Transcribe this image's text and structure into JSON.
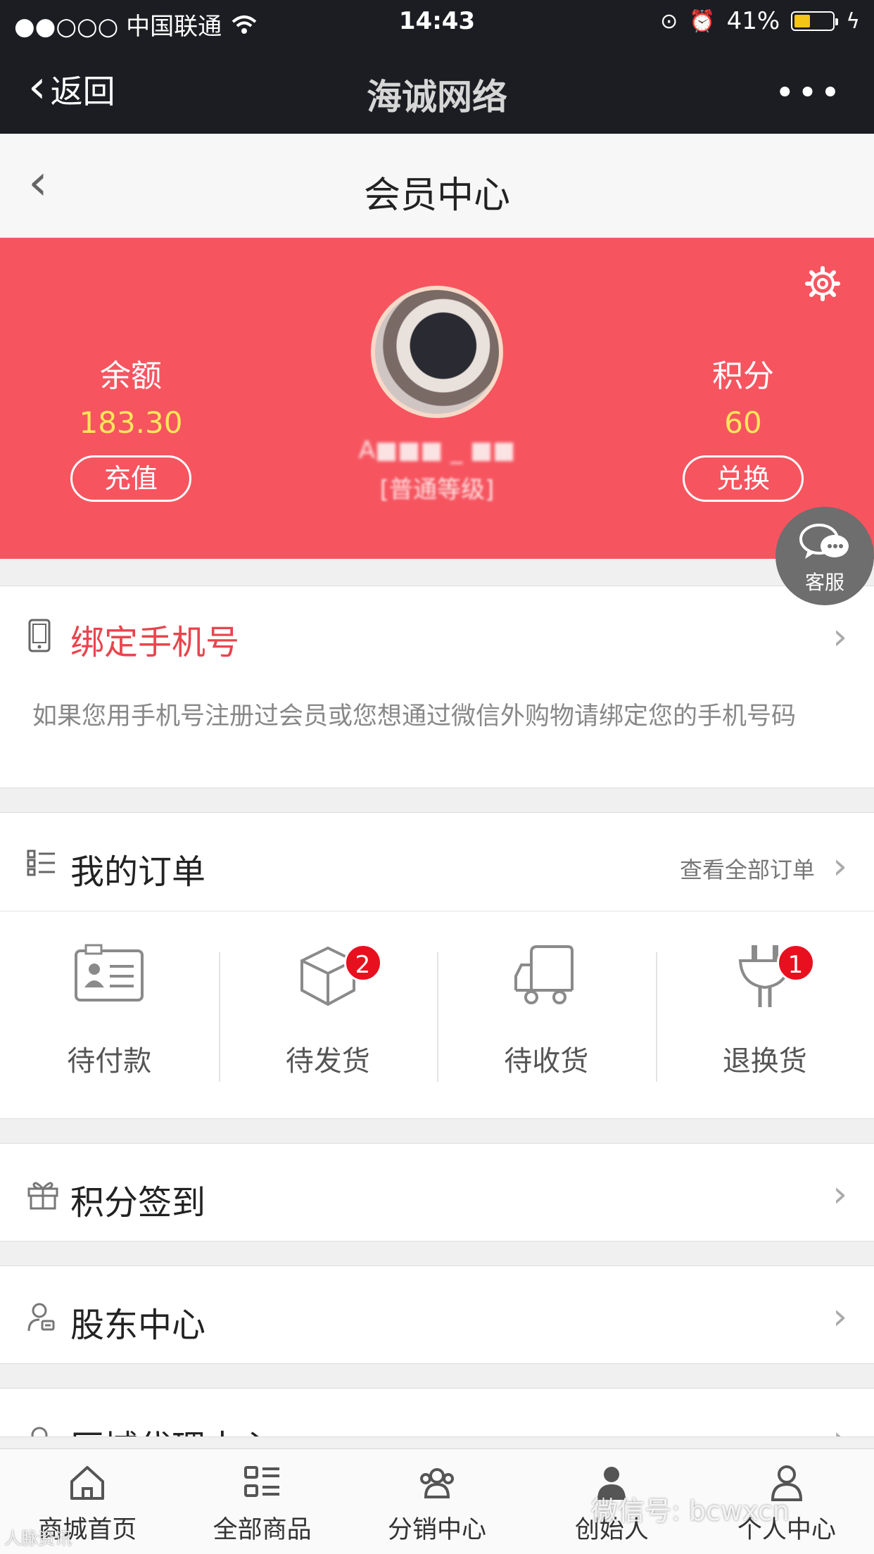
{
  "status_bar": {
    "carrier": "●●○○○ 中国联通",
    "time": "14:43",
    "battery": "41%"
  },
  "wechat_nav": {
    "back_label": "返回",
    "title": "海诚网络",
    "more": "•••"
  },
  "header": {
    "back": "‹",
    "title": "会员中心"
  },
  "member": {
    "balance_label": "余额",
    "balance_value": "183.30",
    "recharge_button": "充值",
    "points_label": "积分",
    "points_value": "60",
    "exchange_button": "兑换",
    "username": "A■■■ _ ■■",
    "level": "[普通等级]",
    "accent_color": "#f65560",
    "value_color": "#ffe65a"
  },
  "customer_service": {
    "label": "客服"
  },
  "bind_phone": {
    "title": "绑定手机号",
    "description": "如果您用手机号注册过会员或您想通过微信外购物请绑定您的手机号码"
  },
  "orders": {
    "title": "我的订单",
    "view_all": "查看全部订单",
    "items": [
      {
        "label": "待付款",
        "icon": "id-card-icon",
        "badge": ""
      },
      {
        "label": "待发货",
        "icon": "box-icon",
        "badge": "2"
      },
      {
        "label": "待收货",
        "icon": "truck-icon",
        "badge": ""
      },
      {
        "label": "退换货",
        "icon": "plug-icon",
        "badge": "1"
      }
    ]
  },
  "menu": {
    "sign_in": "积分签到",
    "shareholder": "股东中心",
    "region_agent": "区域代理中心"
  },
  "tabbar": {
    "items": [
      {
        "label": "商城首页"
      },
      {
        "label": "全部商品"
      },
      {
        "label": "分销中心"
      },
      {
        "label": "创始人"
      },
      {
        "label": "个人中心"
      }
    ]
  },
  "watermark": {
    "text": "微信号: bcwxcn",
    "corner": "人脉资讯"
  }
}
